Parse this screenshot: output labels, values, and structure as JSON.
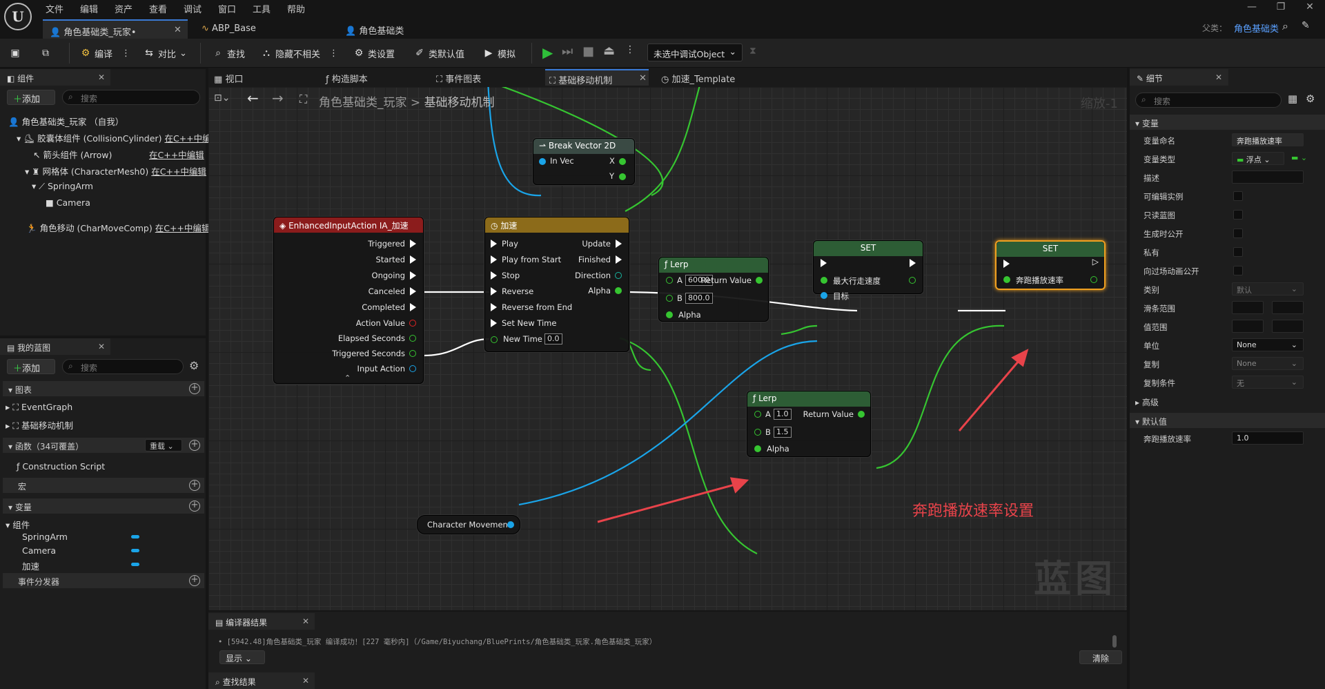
{
  "menu": {
    "items": [
      "文件",
      "编辑",
      "资产",
      "查看",
      "调试",
      "窗口",
      "工具",
      "帮助"
    ]
  },
  "tabs": [
    {
      "label": "角色基础类_玩家•"
    },
    {
      "label": "ABP_Base"
    },
    {
      "label": "角色基础类"
    }
  ],
  "parent": {
    "label": "父类：",
    "value": "角色基础类"
  },
  "toolbar": {
    "compile": "编译",
    "diff": "对比",
    "find": "查找",
    "hide_unrelated": "隐藏不相关",
    "class_settings": "类设置",
    "class_defaults": "类默认值",
    "simulate": "模拟",
    "debug_object": "未选中调试Object"
  },
  "components": {
    "title": "组件",
    "add": "添加",
    "search_placeholder": "搜索",
    "root": "角色基础类_玩家 （自我）",
    "items": [
      {
        "label": "胶囊体组件 (CollisionCylinder)",
        "edit": "在C++中编"
      },
      {
        "label": "箭头组件 (Arrow)",
        "edit": "在C++中编辑"
      },
      {
        "label": "网格体 (CharacterMesh0)",
        "edit": "在C++中编辑"
      },
      {
        "label": "SpringArm",
        "edit": ""
      },
      {
        "label": "Camera",
        "edit": ""
      },
      {
        "label": "角色移动 (CharMoveComp)",
        "edit": "在C++中编辑"
      }
    ]
  },
  "my_blueprint": {
    "title": "我的蓝图",
    "add": "添加",
    "search_placeholder": "搜索",
    "graphs_label": "图表",
    "graphs": [
      "EventGraph",
      "基础移动机制"
    ],
    "functions_label": "函数（34可覆盖）",
    "override": "重载",
    "construction": "Construction Script",
    "macros_label": "宏",
    "variables_label": "变量",
    "components_label": "组件",
    "vars": [
      "SpringArm",
      "Camera",
      "加速"
    ],
    "dispatchers_label": "事件分发器"
  },
  "graph_tabs": [
    {
      "label": "视口"
    },
    {
      "label": "构造脚本"
    },
    {
      "label": "事件图表"
    },
    {
      "label": "基础移动机制"
    },
    {
      "label": "加速_Template"
    }
  ],
  "breadcrumb": {
    "root": "角色基础类_玩家",
    "sep": ">",
    "current": "基础移动机制"
  },
  "zoom": "缩放-1",
  "watermark": "蓝图",
  "annotation": "奔跑播放速率设置",
  "nodes": {
    "break_vec": {
      "title": "Break Vector 2D",
      "in": "In Vec",
      "x": "X",
      "y": "Y"
    },
    "enhanced": {
      "title": "EnhancedInputAction IA_加速",
      "pins": [
        "Triggered",
        "Started",
        "Ongoing",
        "Canceled",
        "Completed",
        "Action Value",
        "Elapsed Seconds",
        "Triggered Seconds",
        "Input Action"
      ]
    },
    "timeline": {
      "title": "加速",
      "inputs": [
        "Play",
        "Play from Start",
        "Stop",
        "Reverse",
        "Reverse from End",
        "Set New Time",
        "New Time"
      ],
      "new_time": "0.0",
      "outputs": [
        "Update",
        "Finished",
        "Direction",
        "Alpha"
      ]
    },
    "lerp1": {
      "title": "Lerp",
      "a_label": "A",
      "a": "600.0",
      "b_label": "B",
      "b": "800.0",
      "alpha": "Alpha",
      "ret": "Return Value"
    },
    "lerp2": {
      "title": "Lerp",
      "a_label": "A",
      "a": "1.0",
      "b_label": "B",
      "b": "1.5",
      "alpha": "Alpha",
      "ret": "Return Value"
    },
    "set1": {
      "title": "SET",
      "pin": "最大行走速度",
      "target": "目标"
    },
    "set2": {
      "title": "SET",
      "pin": "奔跑播放速率"
    },
    "charmove": {
      "title": "Character Movement"
    }
  },
  "details": {
    "title": "细节",
    "search_placeholder": "搜索",
    "var_section": "变量",
    "rows": [
      {
        "label": "变量命名",
        "value": "奔跑播放速率"
      },
      {
        "label": "变量类型",
        "value": "浮点"
      },
      {
        "label": "描述",
        "value": ""
      },
      {
        "label": "可编辑实例",
        "value": ""
      },
      {
        "label": "只读蓝图",
        "value": ""
      },
      {
        "label": "生成时公开",
        "value": ""
      },
      {
        "label": "私有",
        "value": ""
      },
      {
        "label": "向过场动画公开",
        "value": ""
      },
      {
        "label": "类别",
        "value": "默认"
      },
      {
        "label": "滑条范围",
        "value": ""
      },
      {
        "label": "值范围",
        "value": ""
      },
      {
        "label": "单位",
        "value": "None"
      },
      {
        "label": "复制",
        "value": "None"
      },
      {
        "label": "复制条件",
        "value": "无"
      }
    ],
    "advanced": "高级",
    "defaults_section": "默认值",
    "default_label": "奔跑播放速率",
    "default_value": "1.0"
  },
  "bottom": {
    "compiler_title": "编译器结果",
    "log": "[5942.48]角色基础类_玩家 编译成功！[227 毫秒内]（/Game/Biyuchang/BluePrints/角色基础类_玩家.角色基础类_玩家）",
    "show": "显示",
    "clear": "清除",
    "find_title": "查找结果"
  },
  "colors": {
    "accent": "#3a7ad6",
    "exec": "#ffffff",
    "float_pin": "#36c531",
    "object_pin": "#1aa4e8",
    "set_header": "#2d5d35",
    "timeline_header": "#8c6b1a",
    "event_header": "#8b1c1c",
    "annotation": "#e8434a"
  }
}
